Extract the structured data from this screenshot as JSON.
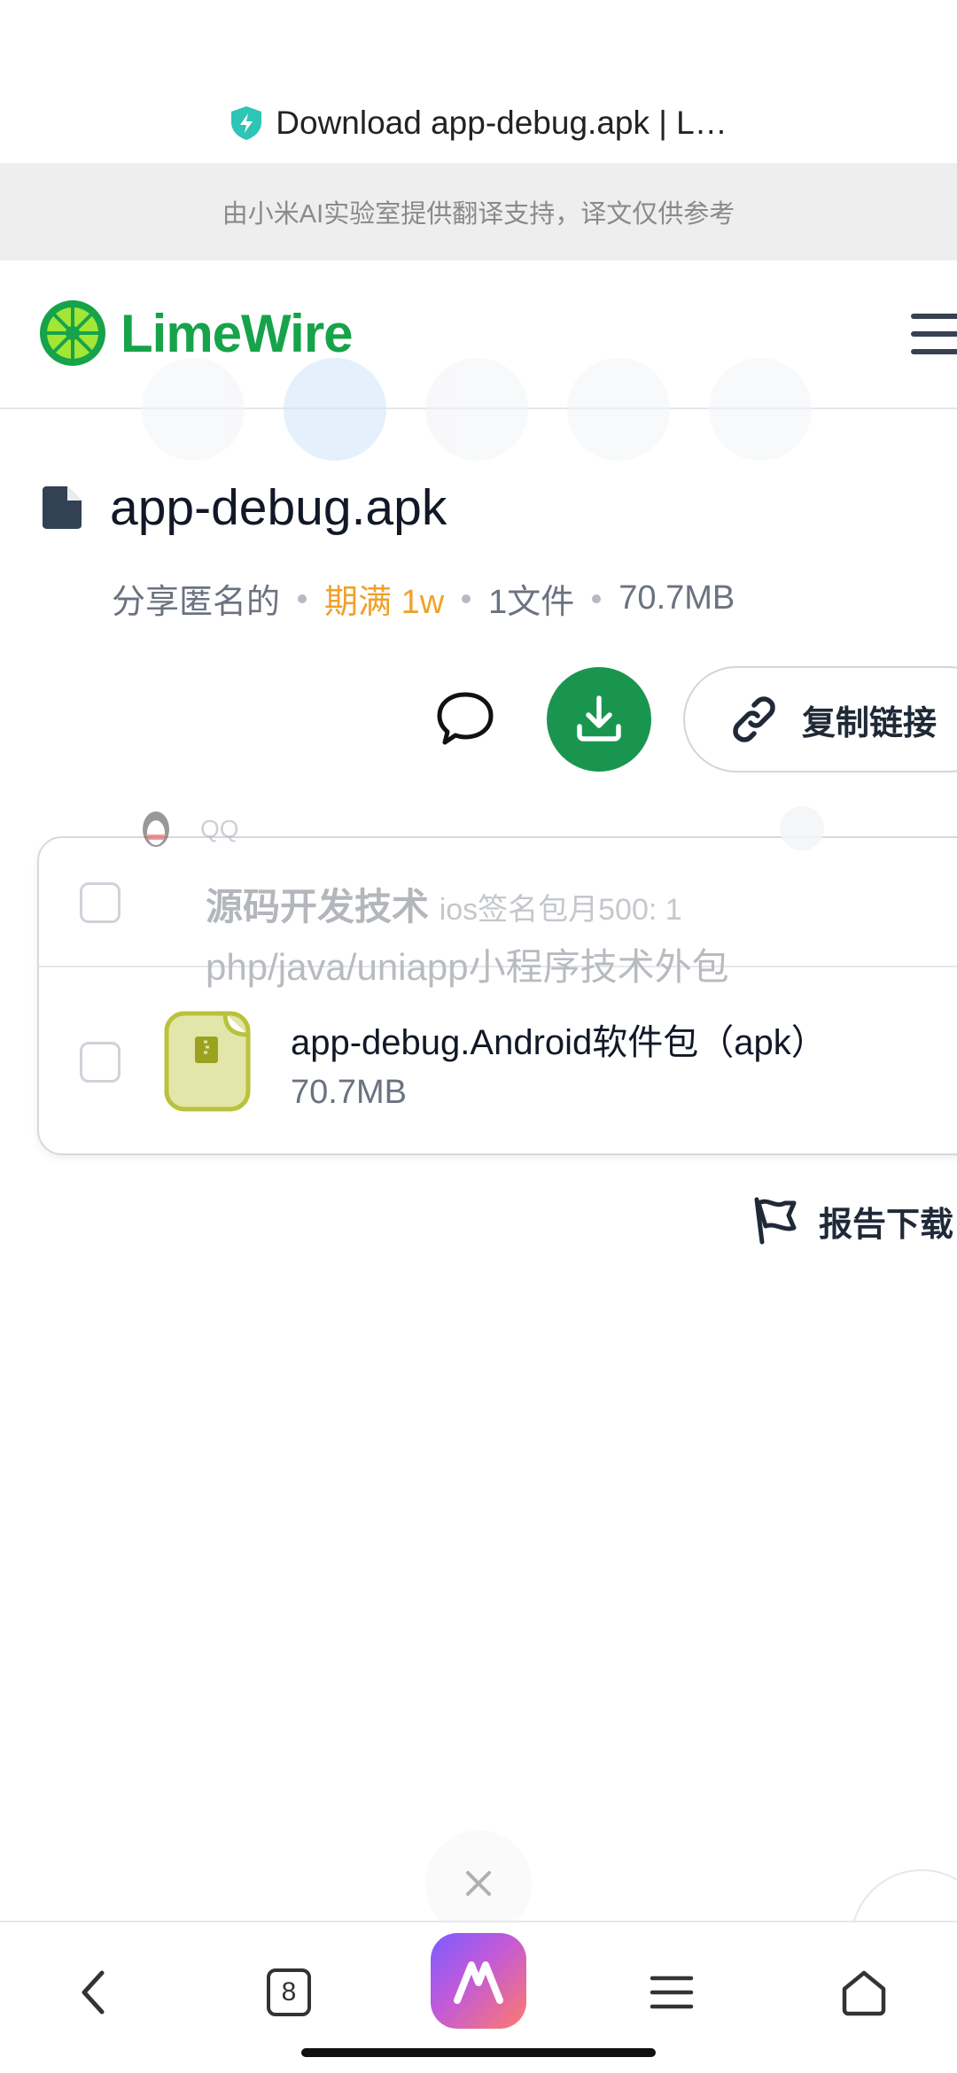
{
  "browser": {
    "tab_title": "Download app-debug.apk | L…"
  },
  "translation_banner": {
    "text": "由小米AI实验室提供翻译支持，译文仅供参考"
  },
  "header": {
    "logo_text": "LimeWire",
    "menu_icon": "hamburger-menu-icon"
  },
  "file": {
    "icon": "document-icon",
    "name": "app-debug.apk",
    "meta": {
      "shared_by": "分享匿名的",
      "expiry": "期满 1w",
      "file_count": "1文件",
      "size": "70.7MB"
    }
  },
  "actions": {
    "comment_icon": "comment-icon",
    "download_icon": "download-icon",
    "copy_link_label": "复制链接",
    "copy_link_icon": "link-icon"
  },
  "file_list": {
    "items": [
      {
        "name": "app-debug.Android软件包（apk）",
        "size": "70.7MB",
        "icon": "zip-file-icon"
      }
    ]
  },
  "overlay_notification": {
    "app": "QQ",
    "title": "源码开发技术",
    "subtitle": "ios签名包月500: 1",
    "body": "php/java/uniapp小程序技术外包"
  },
  "report": {
    "label": "报告下载",
    "icon": "flag-icon"
  },
  "bottom_nav": {
    "tab_count": "8",
    "items": [
      "back-icon",
      "tabs-icon",
      "ai-assistant-icon",
      "menu-icon",
      "home-icon"
    ]
  },
  "colors": {
    "brand_green": "#1a9550",
    "expiry_orange": "#f0a12a"
  }
}
